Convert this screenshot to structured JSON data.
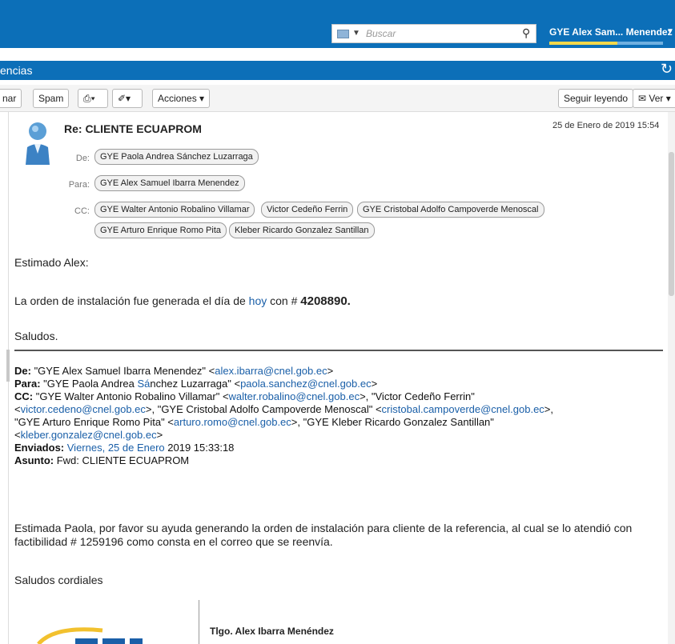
{
  "header": {
    "search_placeholder": "Buscar",
    "user_name": "GYE Alex Sam... Menendez",
    "quota_fraction": 0.6
  },
  "folder": {
    "title": "encias"
  },
  "toolbar": {
    "forward_partial": "nar",
    "spam_label": "Spam",
    "acciones_label": "Acciones",
    "seguir_label": "Seguir leyendo",
    "ver_label": "Ver"
  },
  "message": {
    "subject": "Re: CLIENTE ECUAPROM",
    "date": "25 de Enero de 2019 15:54",
    "de_label": "De:",
    "para_label": "Para:",
    "cc_label": "CC:",
    "from": "GYE Paola Andrea Sánchez Luzarraga",
    "to": "GYE Alex Samuel Ibarra Menendez",
    "cc": [
      "GYE Walter Antonio Robalino Villamar",
      "Victor Cedeño Ferrin",
      "GYE Cristobal Adolfo Campoverde Menoscal",
      "GYE Arturo Enrique Romo Pita",
      "Kleber Ricardo Gonzalez Santillan"
    ],
    "greeting": "Estimado Alex:",
    "line1_pre": "La orden de instalación fue generada el día de ",
    "line1_link": "hoy",
    "line1_mid": " con # ",
    "line1_num": "4208890.",
    "closing": "Saludos."
  },
  "forwarded": {
    "de_label": "De:",
    "de_name": " \"GYE Alex Samuel Ibarra Menendez\" <",
    "de_email": "alex.ibarra@cnel.gob.ec",
    "para_label": "Para:",
    "para_name_a": " \"GYE Paola Andrea ",
    "para_name_link": "Sá",
    "para_name_b": "nchez Luzarraga\" <",
    "para_email": "paola.sanchez@cnel.gob.ec",
    "cc_label": "CC:",
    "cc1_name": " \"GYE Walter Antonio Robalino Villamar\" <",
    "cc1_email": "walter.robalino@cnel.gob.ec",
    "cc2_name": ">, \"Victor Cedeño Ferrin\"",
    "cc2_email": "victor.cedeno@cnel.gob.ec",
    "cc3_name": ">, \"GYE Cristobal Adolfo Campoverde Menoscal\" <",
    "cc3_email": "cristobal.campoverde@cnel.gob.ec",
    "cc4_name": "\"GYE Arturo Enrique Romo Pita\" <",
    "cc4_email": "arturo.romo@cnel.gob.ec",
    "cc5_name": ">, \"GYE Kleber Ricardo Gonzalez Santillan\"",
    "cc5_email": "kleber.gonzalez@cnel.gob.ec",
    "enviados_label": "Enviados:",
    "enviados_link": "Viernes, 25 de Enero",
    "enviados_rest": " 2019 15:33:18",
    "asunto_label": "Asunto:",
    "asunto": " Fwd: CLIENTE ECUAPROM",
    "body": "Estimada Paola, por favor su ayuda generando la orden de instalación para cliente de la referencia, al cual se lo atendió con factibilidad # 1259196 como consta en el correo que se reenvía.",
    "closing": "Saludos cordiales",
    "signature_name": "Tlgo. Alex Ibarra Menéndez"
  },
  "colors": {
    "accent": "#0c6fb8",
    "link": "#1a5fa8"
  }
}
